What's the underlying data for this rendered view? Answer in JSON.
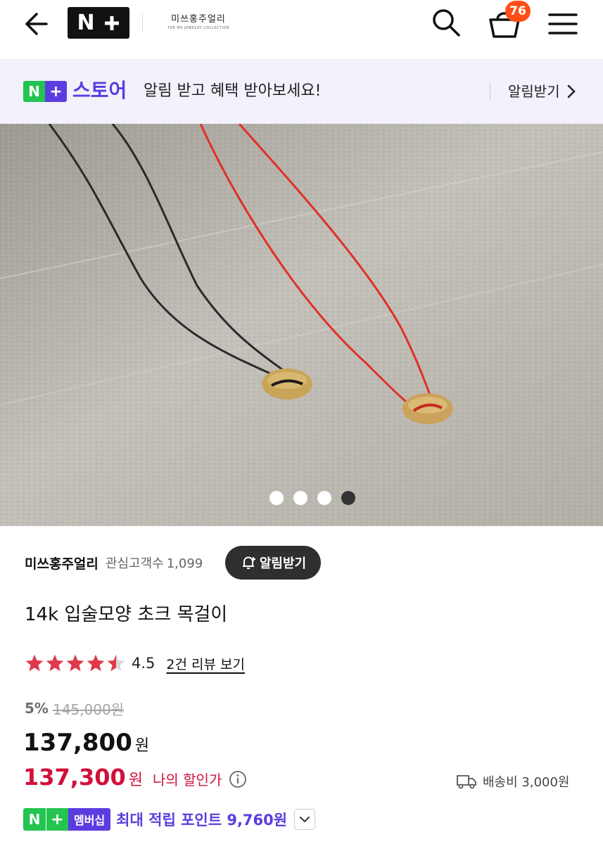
{
  "header": {
    "back_icon": "back-arrow-icon",
    "logo_text": "N+",
    "brand_logo_main": "미쓰홍주얼리",
    "brand_logo_sub": "THE MS JEWELRY COLLECTION",
    "search_icon": "search-icon",
    "cart_icon": "cart-icon",
    "cart_count": "76",
    "menu_icon": "menu-icon"
  },
  "notice": {
    "badge_n": "N",
    "badge_plus": "+",
    "store_word": "스토어",
    "text": "알림 받고 혜택 받아보세요!",
    "cta": "알림받기"
  },
  "gallery": {
    "total": 4,
    "active_index": 3
  },
  "seller": {
    "name": "미쓰홍주얼리",
    "fav_label": "관심고객수",
    "fav_count": "1,099",
    "notify_label": "알림받기"
  },
  "product": {
    "title": "14k 입술모양 초크 목걸이",
    "rating": "4.5",
    "rating_value": 4.5,
    "review_link": "2건 리뷰 보기",
    "discount": "5%",
    "original_price": "145,000원",
    "price": "137,800",
    "price_unit": "원",
    "my_price": "137,300",
    "my_price_unit": "원",
    "my_price_label": "나의 할인가",
    "shipping": "배송비 3,000원"
  },
  "membership": {
    "badge_n": "N",
    "badge_plus": "+",
    "badge_label": "멤버십",
    "text": "최대 적립 포인트 9,760원"
  },
  "colors": {
    "store_purple": "#5b3ce0",
    "store_green": "#23c44f",
    "sale_red": "#d0103a",
    "badge_orange": "#ff4e16",
    "star_red": "#e0394b"
  }
}
